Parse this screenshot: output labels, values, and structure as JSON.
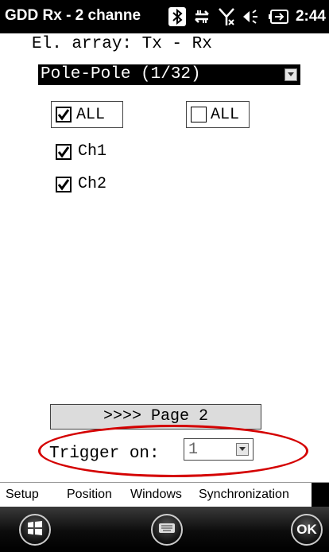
{
  "titlebar": {
    "title": "GDD Rx - 2 channe",
    "time": "2:44",
    "icons": [
      "bluetooth-icon",
      "data-transfer-icon",
      "no-signal-icon",
      "volume-icon",
      "battery-charging-icon"
    ]
  },
  "form": {
    "array_label": "El. array: Tx - Rx",
    "array_value": "Pole-Pole (1/32)",
    "check_all": {
      "label": "ALL",
      "checked": true
    },
    "uncheck_all": {
      "label": "ALL",
      "checked": false
    },
    "channels": [
      {
        "label": "Ch1",
        "checked": true
      },
      {
        "label": "Ch2",
        "checked": true
      }
    ],
    "page_button": ">>>> Page 2",
    "trigger_label": "Trigger on:",
    "trigger_value": "1"
  },
  "tabs": [
    {
      "label": "Setup",
      "active": true
    },
    {
      "label": "Position",
      "active": false
    },
    {
      "label": "Windows",
      "active": false
    },
    {
      "label": "Synchronization",
      "active": false
    }
  ],
  "softkeys": {
    "left_icon": "windows-start-icon",
    "middle_icon": "keyboard-icon",
    "right_label": "OK"
  },
  "colors": {
    "highlight_ellipse": "#d40000",
    "titlebar_bg": "#000000",
    "dropdown_bg": "#000000"
  }
}
